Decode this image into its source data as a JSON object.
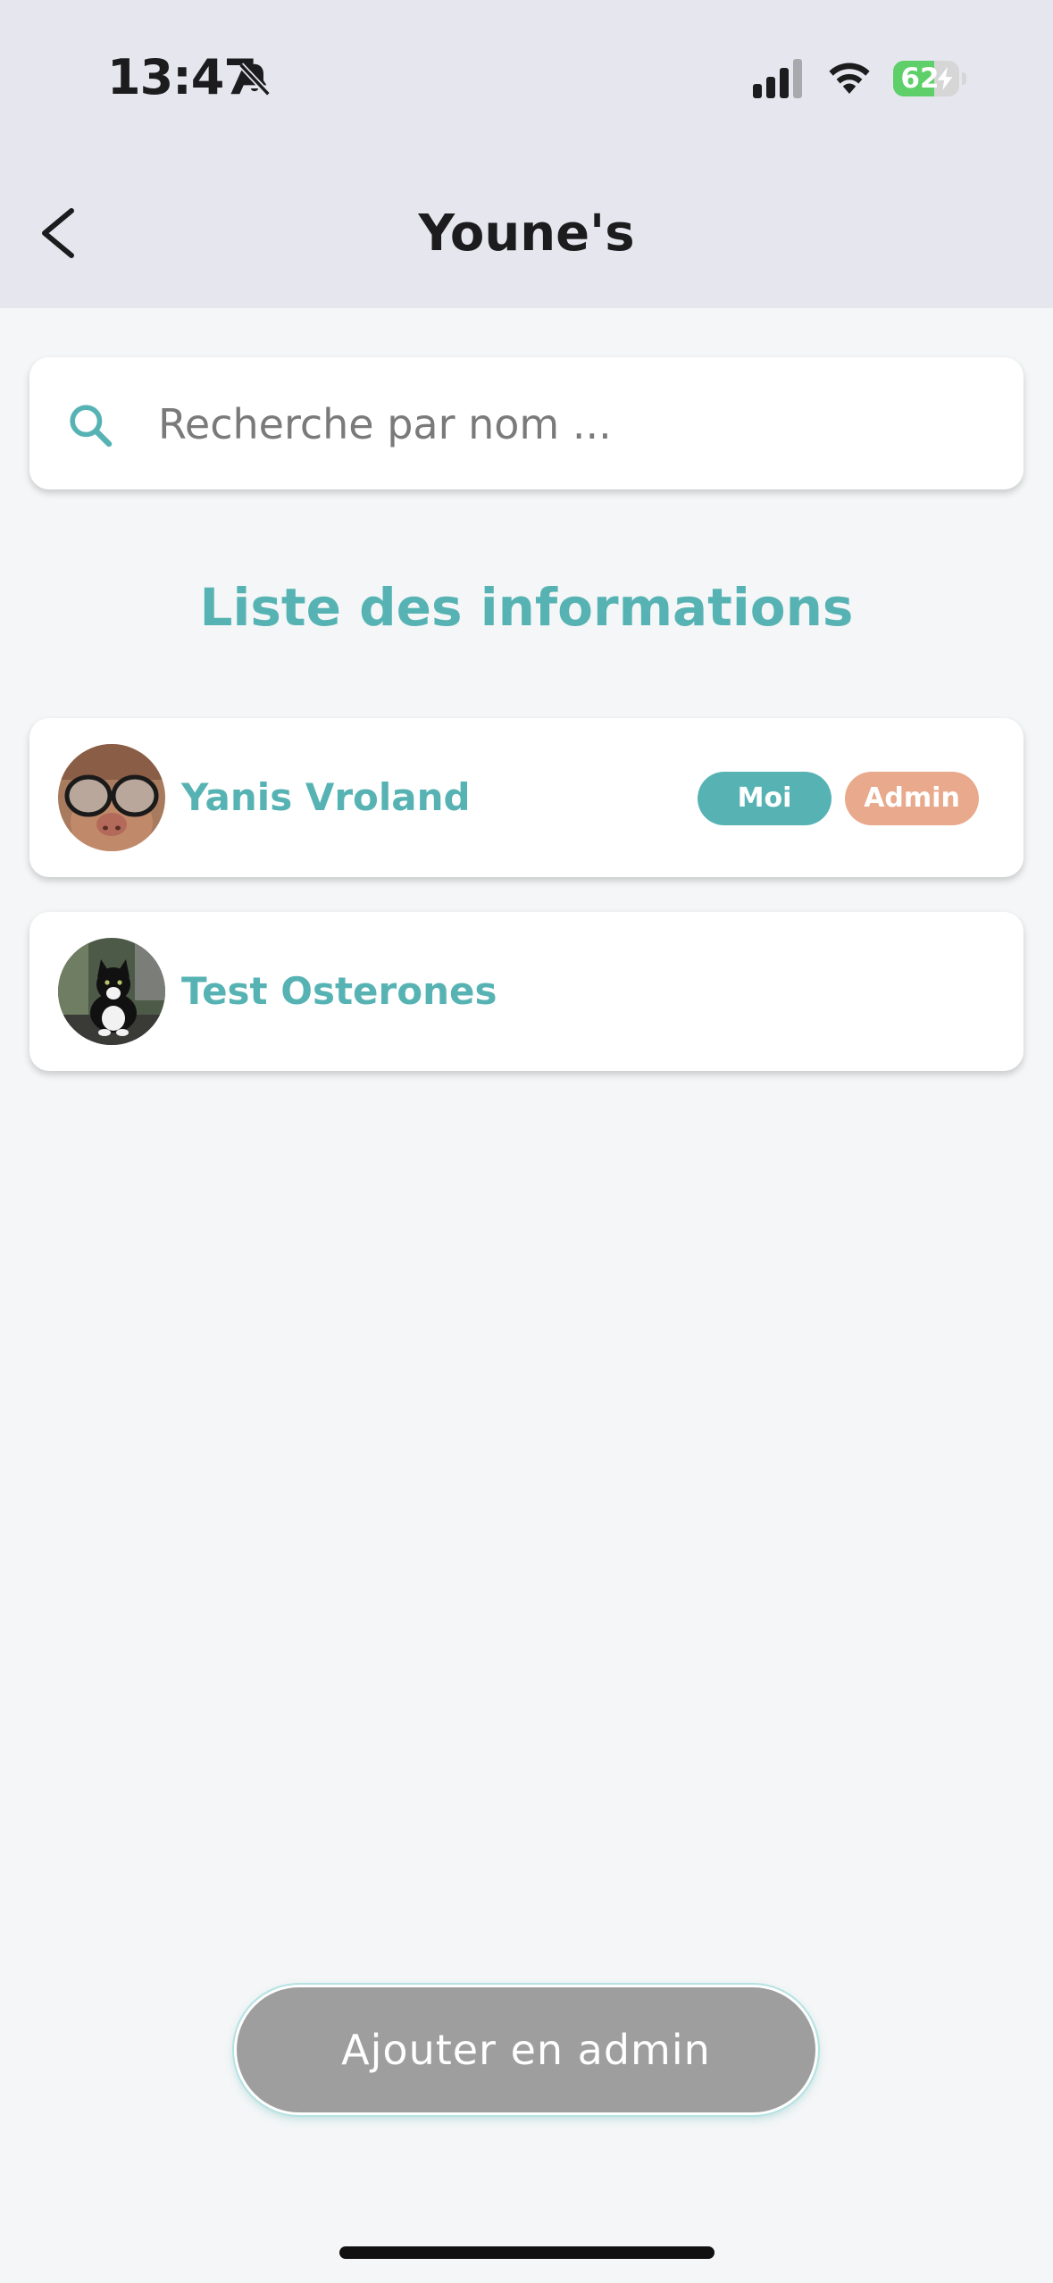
{
  "status_bar": {
    "time": "13:47",
    "battery": "62",
    "icons": [
      "bell-slash-icon",
      "cellular-signal-icon",
      "wifi-icon",
      "battery-charging-icon"
    ]
  },
  "nav": {
    "title": "Youne's",
    "back_icon": "chevron-left-icon"
  },
  "search": {
    "placeholder": "Recherche par nom ...",
    "value": "",
    "icon": "search-icon"
  },
  "list": {
    "title": "Liste des informations",
    "members": [
      {
        "name": "Yanis Vroland",
        "badges": [
          "Moi",
          "Admin"
        ]
      },
      {
        "name": "Test Osterones",
        "badges": []
      }
    ]
  },
  "actions": {
    "add_admin_label": "Ajouter en admin"
  },
  "colors": {
    "accent": "#57b3b3",
    "admin_badge": "#e8a98c",
    "button_disabled": "#9e9e9e",
    "header_bg": "#e6e7ee",
    "page_bg": "#f4f6f7"
  }
}
